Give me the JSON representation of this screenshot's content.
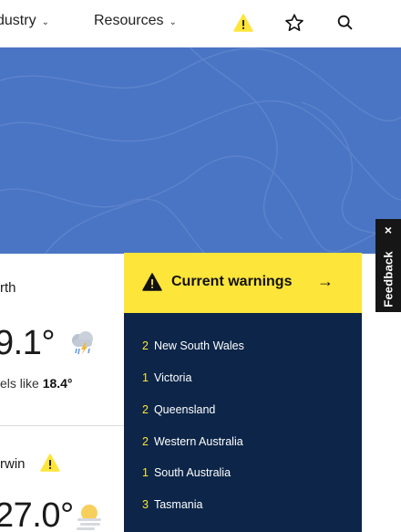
{
  "nav": {
    "industry_label": "dustry",
    "resources_label": "Resources",
    "chevron": "⌄"
  },
  "colors": {
    "hero_blue": "#4a75c4",
    "warning_yellow": "#fee53a",
    "panel_navy": "#0c2548",
    "feedback_black": "#161616"
  },
  "feedback": {
    "close": "×",
    "label": "Feedback"
  },
  "weather": {
    "perth": {
      "city": "rth",
      "temp": "9.1°",
      "feels_prefix": "els like ",
      "feels_value": "18.4°",
      "icon": "storm-cloud-icon"
    },
    "darwin": {
      "city": "rwin",
      "temp": "27.0°",
      "icon": "hazy-sun-icon"
    }
  },
  "warnings": {
    "title": "Current warnings",
    "arrow": "→",
    "items": [
      {
        "count": "2",
        "state": "New South Wales"
      },
      {
        "count": "1",
        "state": "Victoria"
      },
      {
        "count": "2",
        "state": "Queensland"
      },
      {
        "count": "2",
        "state": "Western Australia"
      },
      {
        "count": "1",
        "state": "South Australia"
      },
      {
        "count": "3",
        "state": "Tasmania"
      }
    ]
  }
}
